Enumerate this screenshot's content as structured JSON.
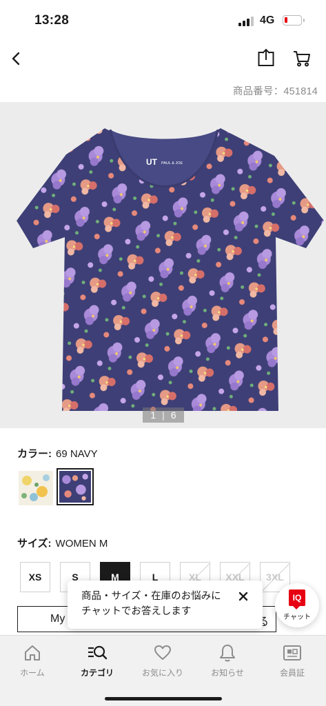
{
  "status_bar": {
    "time": "13:28",
    "network": "4G"
  },
  "header": {
    "back_icon": "chevron-left-icon",
    "share_icon": "share-icon",
    "cart_icon": "cart-icon"
  },
  "product": {
    "number_text": "商品番号：451814",
    "image_pager": {
      "current": "1",
      "separator": "|",
      "total": "6"
    },
    "logo_text": "UT",
    "collab_text": "PAUL & JOE"
  },
  "color": {
    "label": "カラー:",
    "selected": "69 NAVY",
    "swatches": [
      {
        "name": "white-floral",
        "color": "#f3efe2"
      },
      {
        "name": "navy-floral",
        "color": "#3e3f76"
      }
    ]
  },
  "size": {
    "label": "サイズ:",
    "selected": "WOMEN M",
    "options": [
      {
        "label": "XS",
        "state": "available"
      },
      {
        "label": "S",
        "state": "available"
      },
      {
        "label": "M",
        "state": "selected"
      },
      {
        "label": "L",
        "state": "available"
      },
      {
        "label": "XL",
        "state": "unavailable"
      },
      {
        "label": "XXL",
        "state": "unavailable"
      },
      {
        "label": "3XL",
        "state": "unavailable"
      }
    ]
  },
  "my_size": {
    "label_visible": "My",
    "tail_visible": "る"
  },
  "chat_popup": {
    "line1": "商品・サイズ・在庫のお悩みに",
    "line2": "チャットでお答えします",
    "close_icon": "close-icon"
  },
  "iq_chat": {
    "badge": "IQ",
    "label": "チャット"
  },
  "bottom_nav": {
    "items": [
      {
        "label": "ホーム",
        "icon": "home-icon"
      },
      {
        "label": "カテゴリ",
        "icon": "category-search-icon"
      },
      {
        "label": "お気に入り",
        "icon": "heart-icon"
      },
      {
        "label": "お知らせ",
        "icon": "bell-icon"
      },
      {
        "label": "会員証",
        "icon": "member-card-icon"
      }
    ],
    "active_index": 1
  },
  "colors": {
    "accent_red": "#e60012",
    "text_dark": "#1b1b1b",
    "text_muted": "#8a8a8a",
    "shirt_navy": "#3e3f76"
  }
}
